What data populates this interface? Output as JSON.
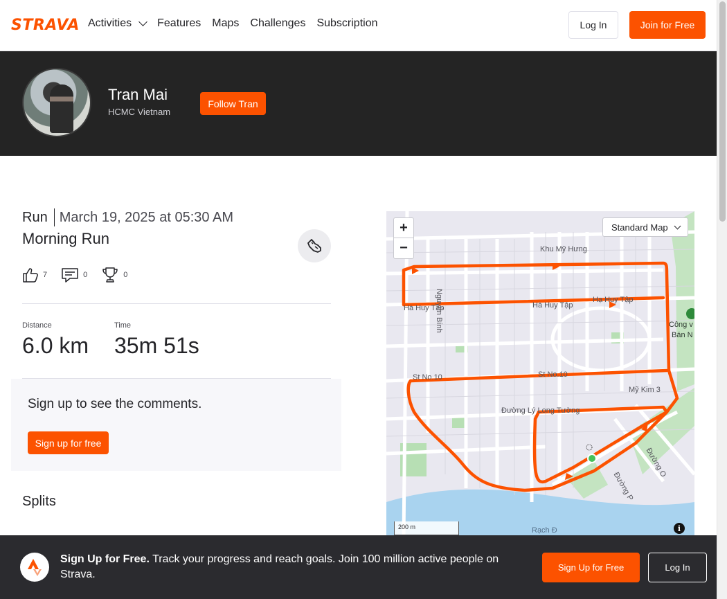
{
  "nav": {
    "logo": "STRAVA",
    "links": [
      "Activities",
      "Features",
      "Maps",
      "Challenges",
      "Subscription"
    ],
    "login": "Log In",
    "join": "Join for Free"
  },
  "profile": {
    "name": "Tran Mai",
    "location": "HCMC Vietnam",
    "follow": "Follow Tran"
  },
  "activity": {
    "type": "Run",
    "date": "March 19, 2025 at 05:30 AM",
    "title": "Morning Run",
    "kudos": "7",
    "comments": "0",
    "achievements": "0",
    "stats": [
      {
        "label": "Distance",
        "value": "6.0 km"
      },
      {
        "label": "Time",
        "value": "35m 51s"
      }
    ]
  },
  "comments_panel": {
    "title": "Sign up to see the comments.",
    "button": "Sign up for free"
  },
  "splits": {
    "title": "Splits"
  },
  "map": {
    "type_selector": "Standard Map",
    "zoom_in": "+",
    "zoom_out": "−",
    "scale": "200 m",
    "info": "i",
    "labels": [
      "Khu Mỹ Hưng",
      "Nguyễn Bính",
      "Hà Huy Tập",
      "Hà Huy Tập",
      "Hạ Huy Tập",
      "Công v",
      "Bán N",
      "St No.10",
      "St No.10",
      "Mỹ Kim 3",
      "Đường Lý Long Tường",
      "Đường O",
      "Đường P",
      "Rạch Đ"
    ],
    "route_color": "#fc5200"
  },
  "footer": {
    "bold": "Sign Up for Free.",
    "text": " Track your progress and reach goals. Join 100 million active people on Strava.",
    "signup": "Sign Up for Free",
    "login": "Log In"
  },
  "colors": {
    "brand": "#fc5200",
    "banner": "#242424",
    "footer": "#2b2b2f"
  }
}
